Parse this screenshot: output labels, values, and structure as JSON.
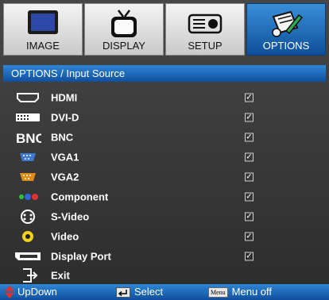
{
  "tabs": [
    {
      "label": "IMAGE",
      "icon": "monitor-icon",
      "active": false
    },
    {
      "label": "DISPLAY",
      "icon": "tv-icon",
      "active": false
    },
    {
      "label": "SETUP",
      "icon": "projector-icon",
      "active": false
    },
    {
      "label": "OPTIONS",
      "icon": "options-pen-icon",
      "active": true
    }
  ],
  "header": {
    "title": "OPTIONS / Input Source"
  },
  "items": [
    {
      "label": "HDMI",
      "icon": "hdmi-port-icon",
      "checked": true
    },
    {
      "label": "DVI-D",
      "icon": "dvi-port-icon",
      "checked": true
    },
    {
      "label": "BNC",
      "icon": "bnc-logo-icon",
      "icon_text": "BNC",
      "checked": true
    },
    {
      "label": "VGA1",
      "icon": "vga-port-blue-icon",
      "checked": true
    },
    {
      "label": "VGA2",
      "icon": "vga-port-orange-icon",
      "checked": true
    },
    {
      "label": "Component",
      "icon": "component-rca-icon",
      "checked": true
    },
    {
      "label": "S-Video",
      "icon": "s-video-connector-icon",
      "checked": true
    },
    {
      "label": "Video",
      "icon": "video-rca-yellow-icon",
      "checked": true
    },
    {
      "label": "Display Port",
      "icon": "displayport-icon",
      "checked": true
    },
    {
      "label": "Exit",
      "icon": "exit-icon"
    }
  ],
  "footer": {
    "updown": "UpDown",
    "select": "Select",
    "menu_key": "Menu",
    "menu_off": "Menu off"
  },
  "colors": {
    "accent_blue": "#1b64b8",
    "background": "#3a3a3a",
    "vga1": "#3f7ad1",
    "vga2": "#e08a18",
    "arrow_red": "#e0302a"
  }
}
